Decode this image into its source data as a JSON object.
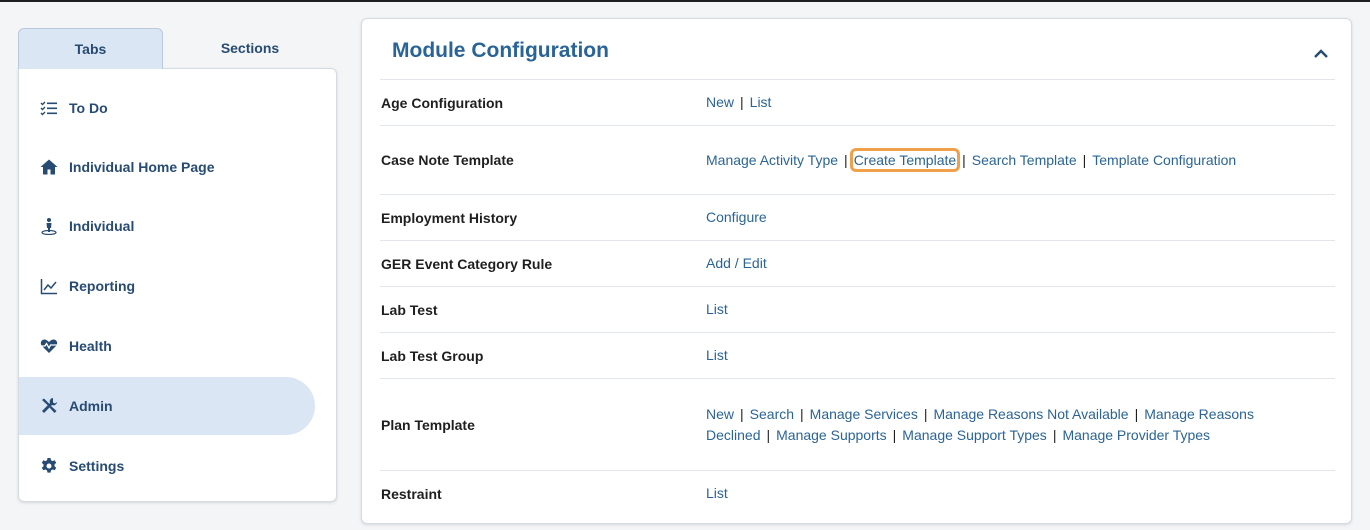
{
  "sidebar": {
    "tabs": [
      {
        "label": "Tabs"
      },
      {
        "label": "Sections"
      }
    ],
    "items": [
      {
        "label": "To Do",
        "icon": "checklist-icon"
      },
      {
        "label": "Individual Home Page",
        "icon": "home-icon"
      },
      {
        "label": "Individual",
        "icon": "person-icon"
      },
      {
        "label": "Reporting",
        "icon": "chart-line-icon"
      },
      {
        "label": "Health",
        "icon": "heartbeat-icon"
      },
      {
        "label": "Admin",
        "icon": "tools-icon",
        "active": true
      },
      {
        "label": "Settings",
        "icon": "gear-icon"
      }
    ]
  },
  "main": {
    "title": "Module Configuration",
    "colors": {
      "link": "#2a6496",
      "highlight": "#f0a04b",
      "active_bg": "#dbe6f5"
    },
    "rows": [
      {
        "label": "Age Configuration",
        "links": [
          "New",
          "List"
        ]
      },
      {
        "label": "Case Note Template",
        "links": [
          "Manage Activity Type",
          "Create Template",
          "Search Template",
          "Template Configuration"
        ],
        "highlighted": "Create Template"
      },
      {
        "label": "Employment History",
        "links": [
          "Configure"
        ]
      },
      {
        "label": "GER Event Category Rule",
        "links": [
          "Add / Edit"
        ]
      },
      {
        "label": "Lab Test",
        "links": [
          "List"
        ]
      },
      {
        "label": "Lab Test Group",
        "links": [
          "List"
        ]
      },
      {
        "label": "Plan Template",
        "links": [
          "New",
          "Search",
          "Manage Services",
          "Manage Reasons Not Available",
          "Manage Reasons Declined",
          "Manage Supports",
          "Manage Support Types",
          "Manage Provider Types"
        ]
      },
      {
        "label": "Restraint",
        "links": [
          "List"
        ]
      }
    ]
  }
}
